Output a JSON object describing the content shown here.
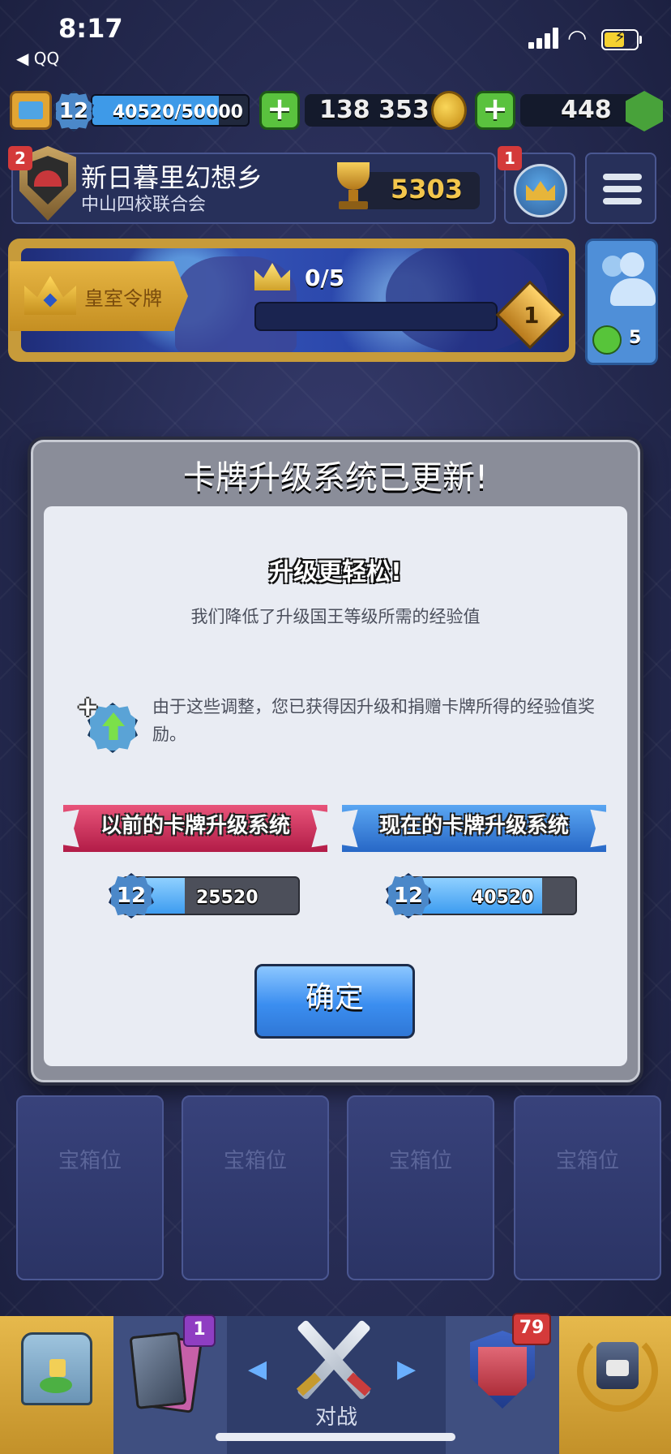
{
  "status_bar": {
    "time": "8:17",
    "back_app": "◀ QQ"
  },
  "resources": {
    "king_level": "12",
    "xp_text": "40520/50000",
    "xp_progress": 0.81,
    "gold": "138 353",
    "gems": "448"
  },
  "clan": {
    "badge": "2",
    "name": "新日暮里幻想乡",
    "subtitle": "中山四校联合会",
    "trophies": "5303",
    "profile_badge": "1"
  },
  "pass_royale": {
    "label": "皇室令牌",
    "crowns": "0/5",
    "crowns_progress": 0,
    "tier": "1",
    "friends_online": "5"
  },
  "modal": {
    "title": "卡牌升级系统已更新!",
    "subheading": "升级更轻松!",
    "description": "我们降低了升级国王等级所需的经验值",
    "bonus_text": "由于这些调整，您已获得因升级和捐赠卡牌所得的经验值奖励。",
    "old_system": {
      "label": "以前的卡牌升级系统",
      "level": "12",
      "xp": "25520",
      "progress": 0.35
    },
    "new_system": {
      "label": "现在的卡牌升级系统",
      "level": "12",
      "xp": "40520",
      "progress": 0.81
    },
    "ok_button": "确定"
  },
  "chest_slots": [
    {
      "label": "宝箱位"
    },
    {
      "label": "宝箱位"
    },
    {
      "label": "宝箱位"
    },
    {
      "label": "宝箱位"
    }
  ],
  "nav": {
    "cards_badge": "1",
    "battle_label": "对战",
    "clan_badge": "79"
  },
  "colors": {
    "xp_blue": "#3e9ae8",
    "ok_button_blue": "#3b8ef0",
    "old_ribbon": "#d6335f",
    "new_ribbon": "#3a7fd9",
    "trophy_gold": "#f3c64c"
  }
}
